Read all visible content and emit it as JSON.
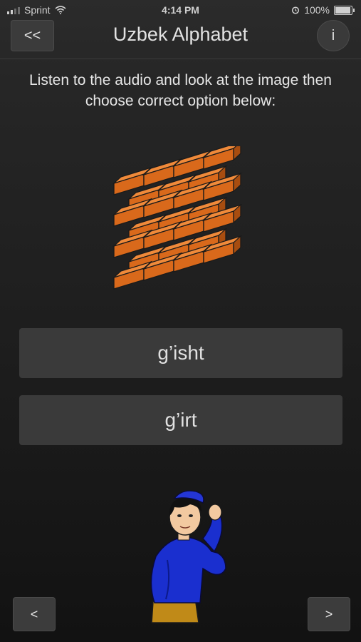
{
  "status_bar": {
    "carrier": "Sprint",
    "time": "4:14 PM",
    "battery": "100%",
    "battery_level": 1.0
  },
  "header": {
    "back_label": "<<",
    "title": "Uzbek Alphabet",
    "info_label": "i"
  },
  "instructions": "Listen to the audio and look at the image then choose correct option below:",
  "image": {
    "subject": "brick-wall",
    "brick_color": "#d9691b"
  },
  "options": [
    {
      "label": "g’isht"
    },
    {
      "label": "g’irt"
    }
  ],
  "footer": {
    "prev_label": "<",
    "next_label": ">"
  },
  "colors": {
    "background": "#1f1f1f",
    "button": "#3a3a3a",
    "text": "#e6e6e6"
  }
}
